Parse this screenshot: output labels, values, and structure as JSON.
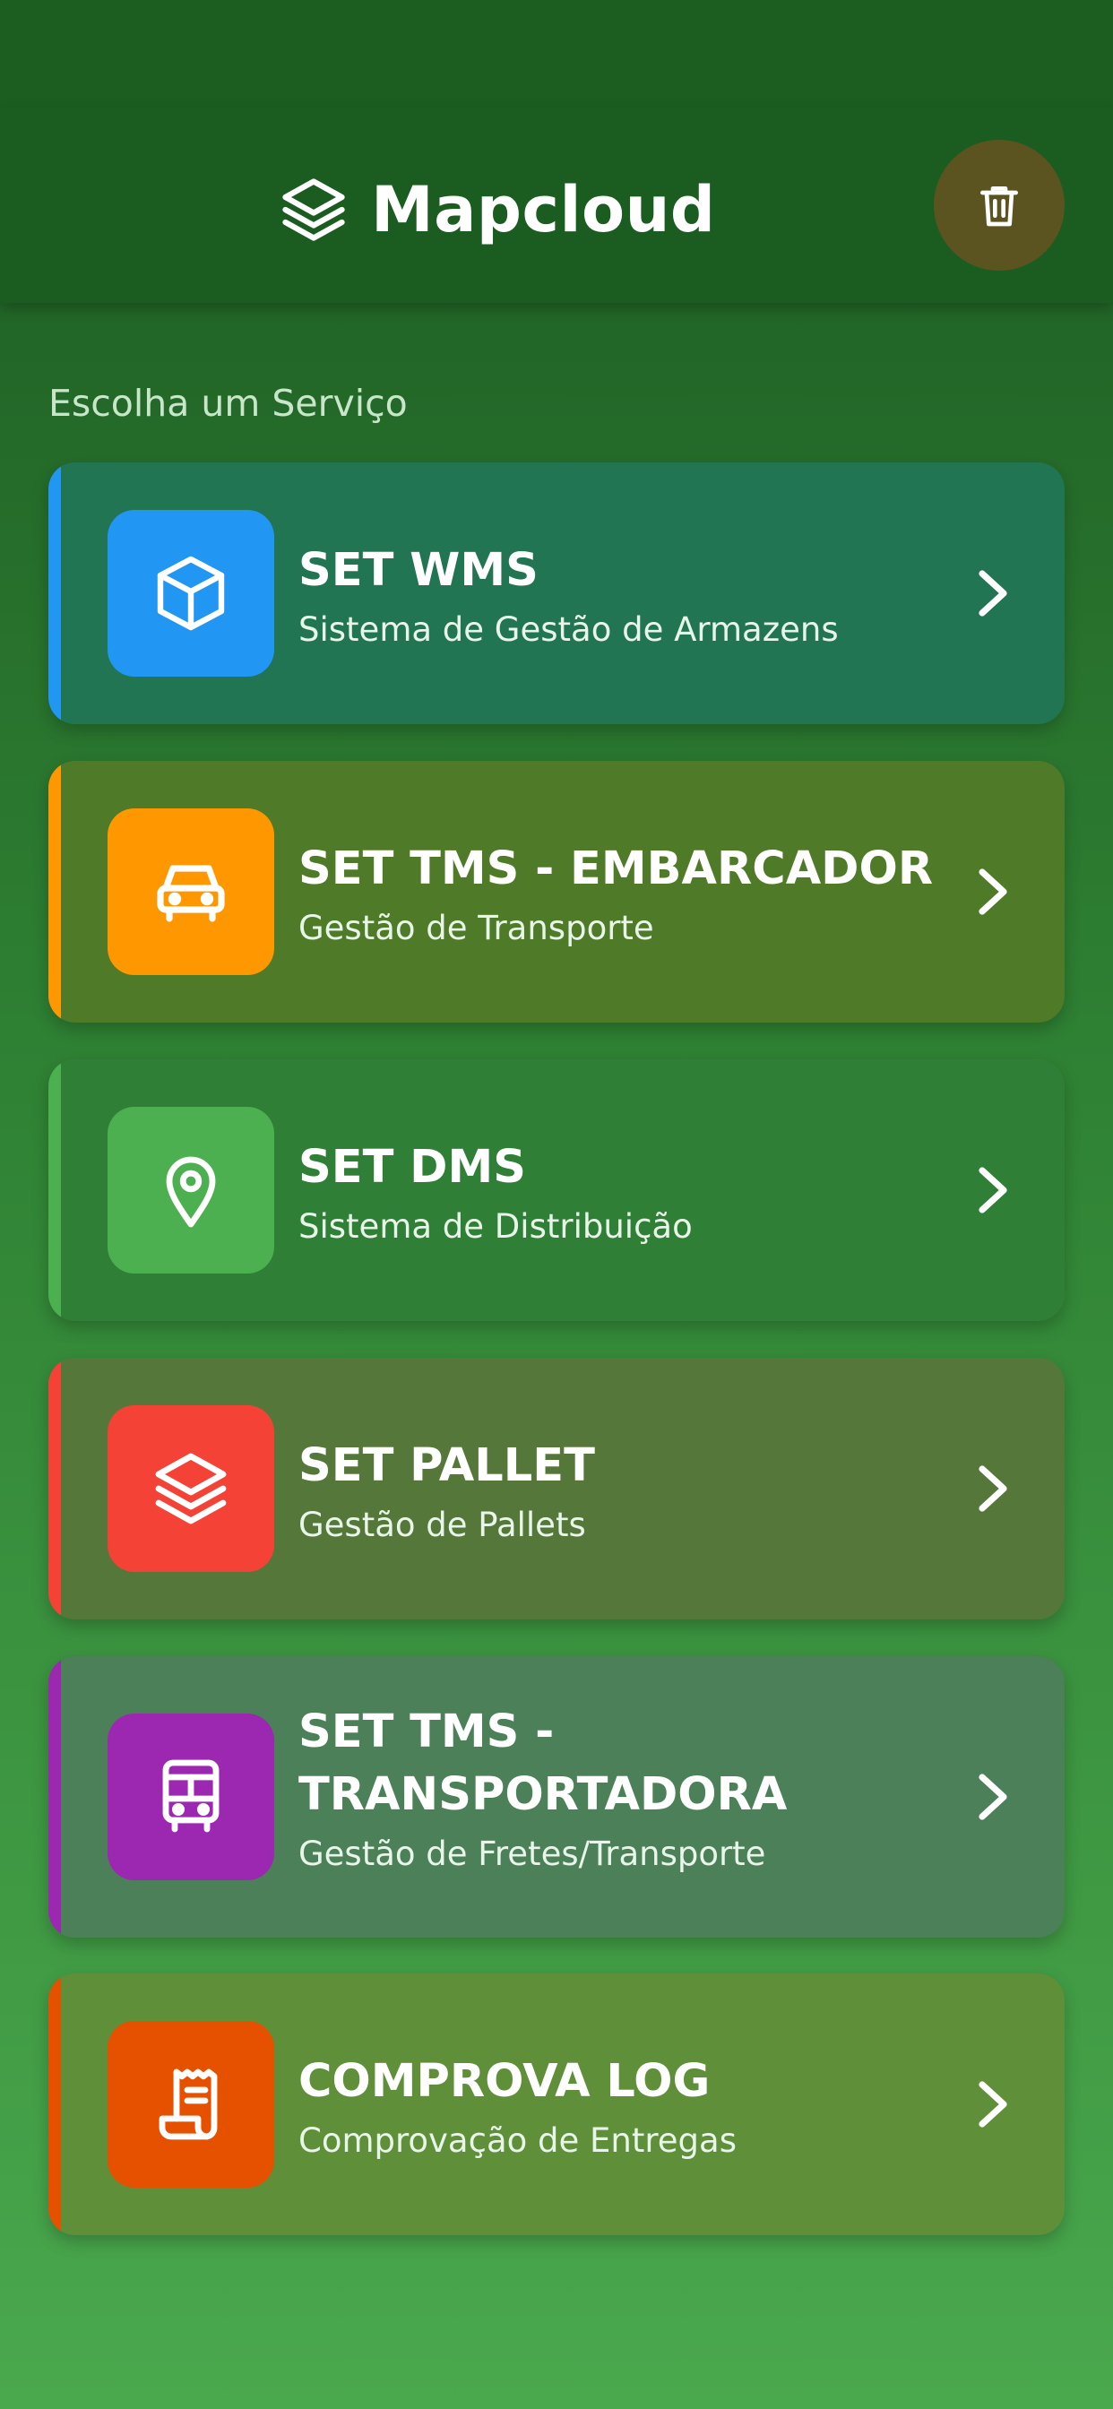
{
  "app": {
    "title": "Mapcloud"
  },
  "section": {
    "title": "Escolha um Serviço"
  },
  "services": [
    {
      "title": "SET WMS",
      "subtitle": "Sistema de Gestão de Armazens",
      "icon": "box-icon",
      "accent": "#2196f3",
      "card_color": "#227552"
    },
    {
      "title": "SET TMS - EMBARCADOR",
      "subtitle": "Gestão de Transporte",
      "icon": "car-icon",
      "accent": "#ff9800",
      "card_color": "#4f7a27"
    },
    {
      "title": "SET DMS",
      "subtitle": "Sistema de Distribuição",
      "icon": "map-pin-icon",
      "accent": "#4caf50",
      "card_color": "#2f8036"
    },
    {
      "title": "SET PALLET",
      "subtitle": "Gestão de Pallets",
      "icon": "layers-icon",
      "accent": "#f44336",
      "card_color": "#56773a"
    },
    {
      "title": "SET TMS - TRANSPORTADORA",
      "subtitle": "Gestão de Fretes/Transporte",
      "icon": "bus-icon",
      "accent": "#9c27b0",
      "card_color": "#4c8058"
    },
    {
      "title": "COMPROVA LOG",
      "subtitle": "Comprovação de Entregas",
      "icon": "receipt-icon",
      "accent": "#e65100",
      "card_color": "#5f8f38"
    }
  ]
}
